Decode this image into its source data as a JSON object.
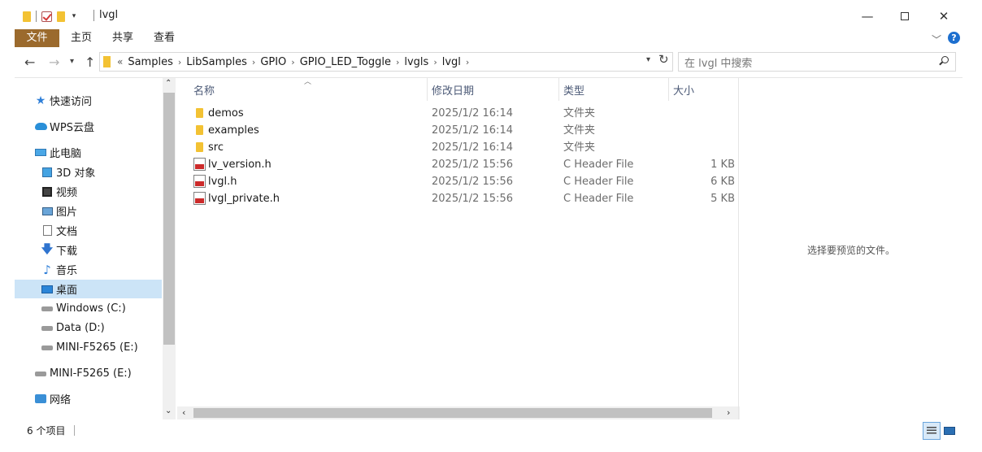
{
  "window": {
    "title": "lvgl"
  },
  "ribbon": {
    "tabs": [
      {
        "label": "文件"
      },
      {
        "label": "主页"
      },
      {
        "label": "共享"
      },
      {
        "label": "查看"
      }
    ]
  },
  "breadcrumb": {
    "more_label": "«",
    "items": [
      "Samples",
      "LibSamples",
      "GPIO",
      "GPIO_LED_Toggle",
      "lvgls",
      "lvgl"
    ]
  },
  "search": {
    "placeholder": "在 lvgl 中搜索"
  },
  "sidebar": {
    "items": [
      {
        "label": "快速访问",
        "icon": "star-icon"
      },
      {
        "label": "WPS云盘",
        "icon": "cloud-icon"
      },
      {
        "label": "此电脑",
        "icon": "computer-icon"
      },
      {
        "label": "3D 对象",
        "icon": "3d-objects-icon"
      },
      {
        "label": "视频",
        "icon": "video-icon"
      },
      {
        "label": "图片",
        "icon": "pictures-icon"
      },
      {
        "label": "文档",
        "icon": "documents-icon"
      },
      {
        "label": "下载",
        "icon": "download-icon"
      },
      {
        "label": "音乐",
        "icon": "music-icon"
      },
      {
        "label": "桌面",
        "icon": "desktop-icon",
        "selected": true
      },
      {
        "label": "Windows (C:)",
        "icon": "drive-icon"
      },
      {
        "label": "Data (D:)",
        "icon": "drive-icon"
      },
      {
        "label": "MINI-F5265 (E:)",
        "icon": "usb-drive-icon"
      },
      {
        "label": "MINI-F5265 (E:)",
        "icon": "usb-drive-icon"
      },
      {
        "label": "网络",
        "icon": "network-icon"
      }
    ]
  },
  "columns": {
    "name": "名称",
    "date": "修改日期",
    "type": "类型",
    "size": "大小"
  },
  "files": [
    {
      "name": "demos",
      "date": "2025/1/2 16:14",
      "type": "文件夹",
      "size": "",
      "icon": "folder-icon"
    },
    {
      "name": "examples",
      "date": "2025/1/2 16:14",
      "type": "文件夹",
      "size": "",
      "icon": "folder-icon"
    },
    {
      "name": "src",
      "date": "2025/1/2 16:14",
      "type": "文件夹",
      "size": "",
      "icon": "folder-icon"
    },
    {
      "name": "lv_version.h",
      "date": "2025/1/2 15:56",
      "type": "C Header File",
      "size": "1 KB",
      "icon": "c-header-file-icon"
    },
    {
      "name": "lvgl.h",
      "date": "2025/1/2 15:56",
      "type": "C Header File",
      "size": "6 KB",
      "icon": "c-header-file-icon"
    },
    {
      "name": "lvgl_private.h",
      "date": "2025/1/2 15:56",
      "type": "C Header File",
      "size": "5 KB",
      "icon": "c-header-file-icon"
    }
  ],
  "preview": {
    "text": "选择要预览的文件。"
  },
  "status": {
    "count": "6 个项目"
  }
}
